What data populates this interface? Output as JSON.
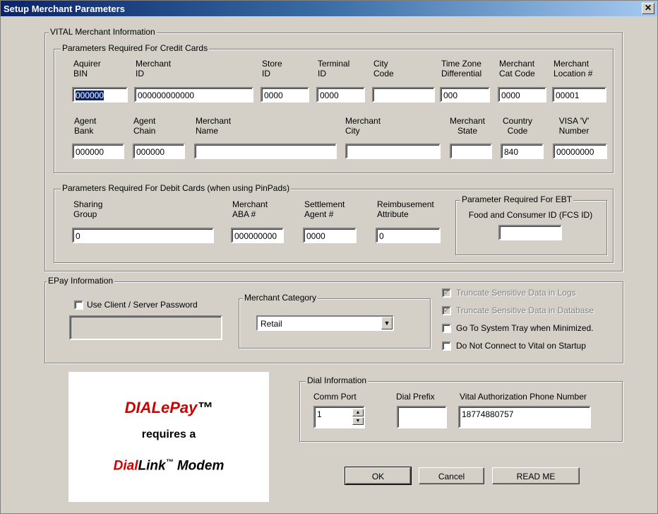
{
  "window": {
    "title": "Setup Merchant Parameters",
    "close_glyph": "✕"
  },
  "vital": {
    "label": "VITAL Merchant Information",
    "credit": {
      "label": "Parameters Required For Credit Cards",
      "row1": [
        {
          "label": "Aquirer\nBIN",
          "value": "000000"
        },
        {
          "label": "Merchant\nID",
          "value": "000000000000"
        },
        {
          "label": "Store\nID",
          "value": "0000"
        },
        {
          "label": "Terminal\nID",
          "value": "0000"
        },
        {
          "label": "City\nCode",
          "value": ""
        },
        {
          "label": "Time Zone\nDifferential",
          "value": "000"
        },
        {
          "label": "Merchant\nCat Code",
          "value": "0000"
        },
        {
          "label": "Merchant\nLocation #",
          "value": "00001"
        }
      ],
      "row2": [
        {
          "label": "Agent\nBank",
          "value": "000000"
        },
        {
          "label": "Agent\nChain",
          "value": "000000"
        },
        {
          "label": "Merchant\nName",
          "value": ""
        },
        {
          "label": "Merchant\nCity",
          "value": ""
        },
        {
          "label": "Merchant\nState",
          "value": ""
        },
        {
          "label": "Country\nCode",
          "value": "840"
        },
        {
          "label": "VISA 'V'\nNumber",
          "value": "00000000"
        }
      ]
    },
    "debit": {
      "label": "Parameters Required For Debit Cards (when using PinPads)",
      "fields": [
        {
          "label": "Sharing\nGroup",
          "value": "0"
        },
        {
          "label": "Merchant\nABA #",
          "value": "000000000"
        },
        {
          "label": "Settlement\nAgent #",
          "value": "0000"
        },
        {
          "label": "Reimbusement\nAttribute",
          "value": "0"
        }
      ]
    },
    "ebt": {
      "label": "Parameter Required For EBT",
      "field_label": "Food and Consumer ID (FCS ID)",
      "value": ""
    }
  },
  "epay": {
    "label": "EPay Information",
    "use_password": {
      "label": "Use Client / Server Password",
      "checked": false
    },
    "password_value": "",
    "category": {
      "label": "Merchant Category",
      "selected": "Retail",
      "arrow": "▼"
    },
    "options": [
      {
        "label": "Truncate Sensitive Data in Logs",
        "checked": true,
        "disabled": true
      },
      {
        "label": "Truncate Sensitive Data in Database",
        "checked": true,
        "disabled": true
      },
      {
        "label": "Go To System Tray when Minimized.",
        "checked": false,
        "disabled": false
      },
      {
        "label": "Do Not Connect to Vital on Startup",
        "checked": false,
        "disabled": false
      }
    ]
  },
  "logo": {
    "line1a": "DIALePay",
    "tm": "™",
    "line2": "requires a",
    "line3a": "Dial",
    "line3b": "Link",
    "line3c": " Modem"
  },
  "dial": {
    "label": "Dial Information",
    "comm_port": {
      "label": "Comm Port",
      "value": "1"
    },
    "dial_prefix": {
      "label": "Dial Prefix",
      "value": ""
    },
    "phone": {
      "label": "Vital Authorization Phone Number",
      "value": "18774880757"
    }
  },
  "buttons": {
    "ok": "OK",
    "cancel": "Cancel",
    "readme": "READ ME"
  },
  "check_glyph": "✓"
}
